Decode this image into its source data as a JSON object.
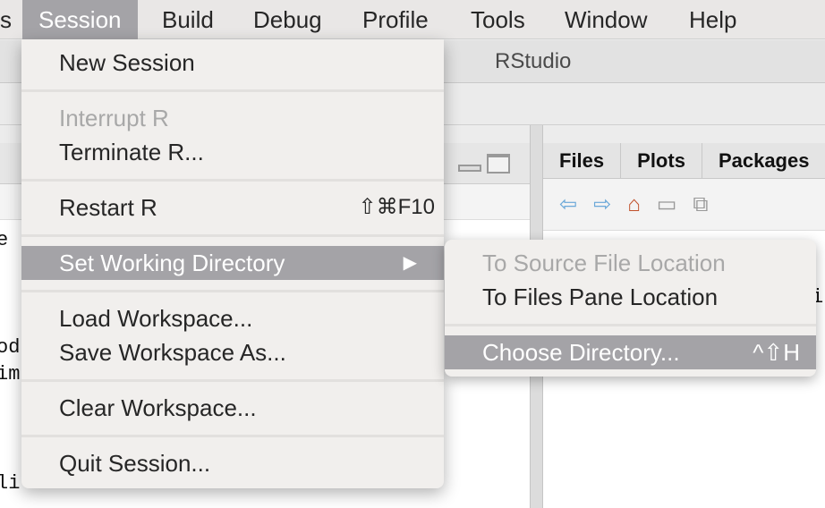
{
  "menubar": {
    "items": [
      {
        "label": "s"
      },
      {
        "label": "Session",
        "active": true
      },
      {
        "label": "Build"
      },
      {
        "label": "Debug"
      },
      {
        "label": "Profile"
      },
      {
        "label": "Tools"
      },
      {
        "label": "Window"
      },
      {
        "label": "Help"
      }
    ]
  },
  "window": {
    "title": "RStudio"
  },
  "right_pane": {
    "tabs": [
      "Files",
      "Plots",
      "Packages"
    ],
    "icons": [
      "back-arrow-icon",
      "forward-arrow-icon",
      "home-icon",
      "print-icon",
      "export-icon"
    ]
  },
  "background_code": [
    "e",
    "od",
    "im",
    "li",
    "il"
  ],
  "session_menu": {
    "items": [
      {
        "label": "New Session"
      },
      {
        "label": "Interrupt R",
        "disabled": true
      },
      {
        "label": "Terminate R..."
      },
      {
        "label": "Restart R",
        "shortcut": "⇧⌘F10"
      },
      {
        "label": "Set Working Directory",
        "highlighted": true,
        "submenu_arrow": "▶"
      },
      {
        "label": "Load Workspace..."
      },
      {
        "label": "Save Workspace As..."
      },
      {
        "label": "Clear Workspace..."
      },
      {
        "label": "Quit Session..."
      }
    ]
  },
  "submenu": {
    "items": [
      {
        "label": "To Source File Location",
        "disabled": true
      },
      {
        "label": "To Files Pane Location"
      },
      {
        "label": "Choose Directory...",
        "shortcut": "^⇧H",
        "highlighted": true
      }
    ]
  },
  "colors": {
    "highlight": "#a4a3a7",
    "menu_bg": "#f1efed",
    "disabled_text": "#a8a8a8"
  }
}
